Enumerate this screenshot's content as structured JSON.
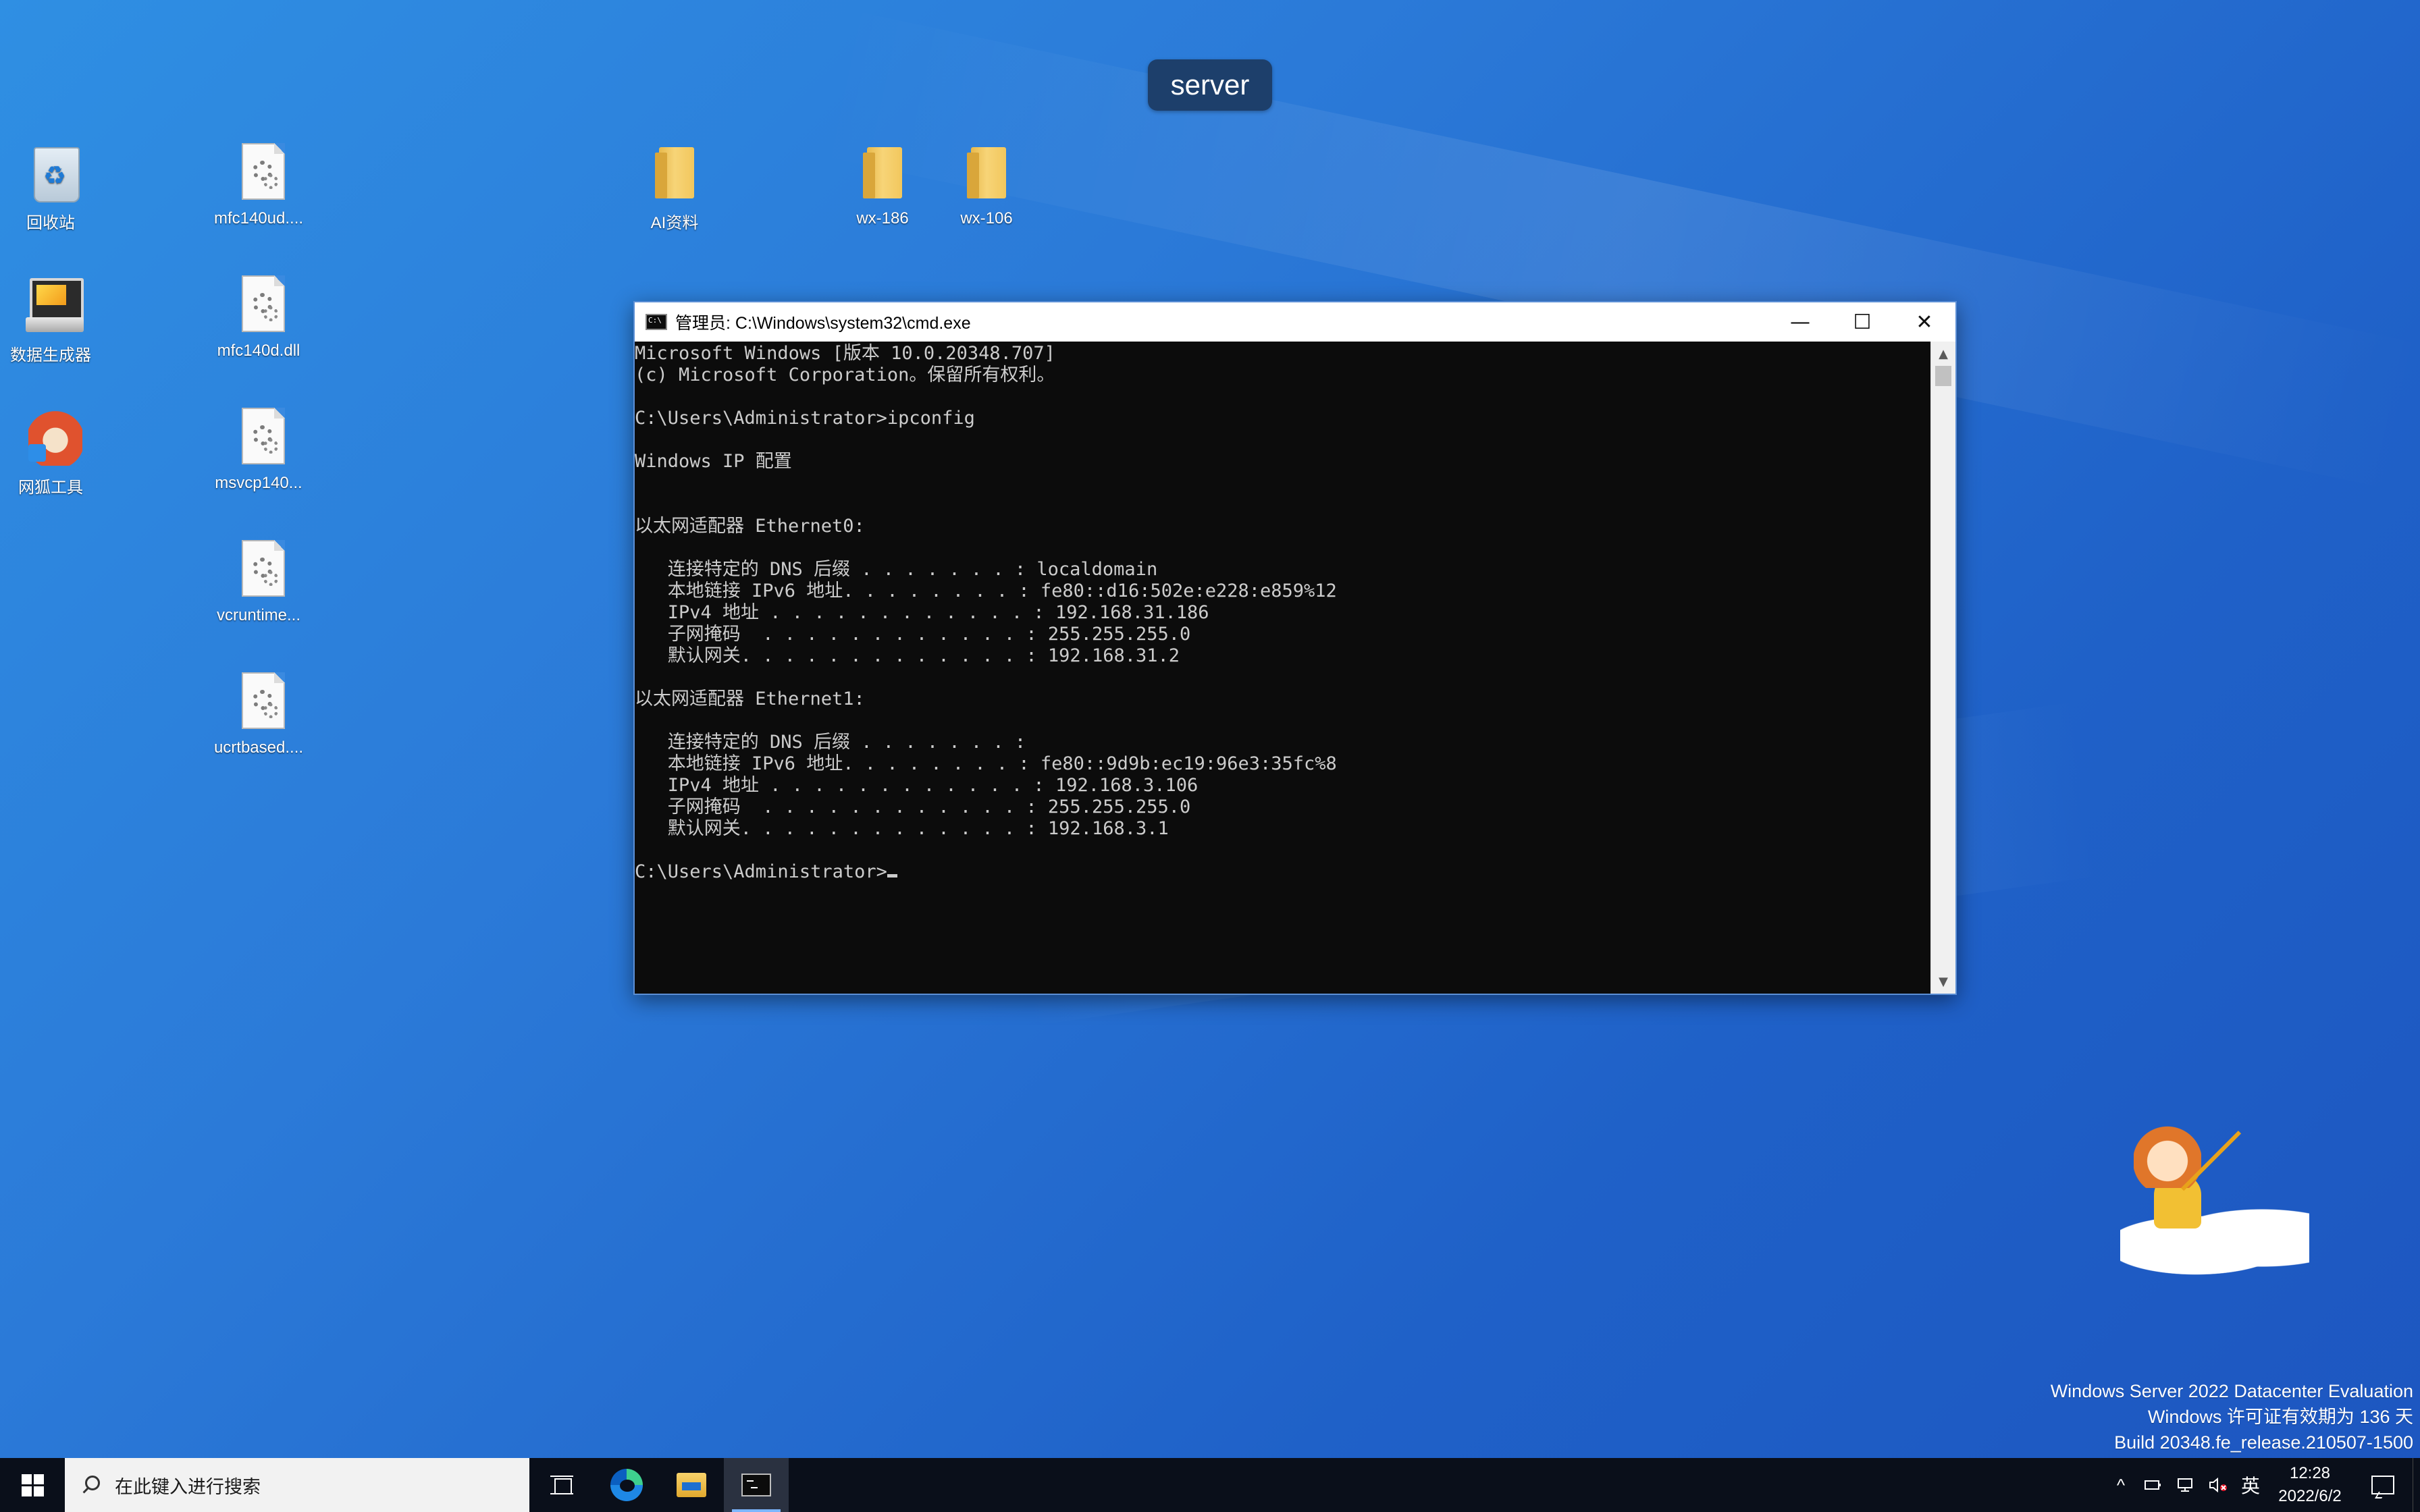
{
  "server_badge": "server",
  "desktop_icons": [
    {
      "label": "回收站",
      "icon": "recycle-bin-icon"
    },
    {
      "label": "mfc140ud....",
      "icon": "dll-file-icon"
    },
    {
      "label": "AI资料",
      "icon": "folder-icon"
    },
    {
      "label": "wx-186",
      "icon": "folder-icon"
    },
    {
      "label": "wx-106",
      "icon": "folder-icon"
    },
    {
      "label": "数据生成器",
      "icon": "computer-shortcut-icon"
    },
    {
      "label": "mfc140d.dll",
      "icon": "dll-file-icon"
    },
    {
      "label": "网狐工具",
      "icon": "fox-tool-icon"
    },
    {
      "label": "msvcp140...",
      "icon": "dll-file-icon"
    },
    {
      "label": "vcruntime...",
      "icon": "dll-file-icon"
    },
    {
      "label": "ucrtbased....",
      "icon": "dll-file-icon"
    }
  ],
  "cmd": {
    "title": "管理员: C:\\Windows\\system32\\cmd.exe",
    "minimize": "—",
    "maximize": "☐",
    "close": "✕",
    "lines": [
      "Microsoft Windows [版本 10.0.20348.707]",
      "(c) Microsoft Corporation。保留所有权利。",
      "",
      "C:\\Users\\Administrator>ipconfig",
      "",
      "Windows IP 配置",
      "",
      "",
      "以太网适配器 Ethernet0:",
      "",
      "   连接特定的 DNS 后缀 . . . . . . . : localdomain",
      "   本地链接 IPv6 地址. . . . . . . . : fe80::d16:502e:e228:e859%12",
      "   IPv4 地址 . . . . . . . . . . . . : 192.168.31.186",
      "   子网掩码  . . . . . . . . . . . . : 255.255.255.0",
      "   默认网关. . . . . . . . . . . . . : 192.168.31.2",
      "",
      "以太网适配器 Ethernet1:",
      "",
      "   连接特定的 DNS 后缀 . . . . . . . :",
      "   本地链接 IPv6 地址. . . . . . . . : fe80::9d9b:ec19:96e3:35fc%8",
      "   IPv4 地址 . . . . . . . . . . . . : 192.168.3.106",
      "   子网掩码  . . . . . . . . . . . . : 255.255.255.0",
      "   默认网关. . . . . . . . . . . . . : 192.168.3.1",
      "",
      "C:\\Users\\Administrator>"
    ],
    "scroll_up": "▲",
    "scroll_down": "▼"
  },
  "watermark": {
    "line1": "Windows Server 2022 Datacenter Evaluation",
    "line2": "Windows 许可证有效期为 136 天",
    "line3": "Build 20348.fe_release.210507-1500"
  },
  "taskbar": {
    "search_placeholder": "在此键入进行搜索",
    "tray": {
      "chevron": "^",
      "ime": "英",
      "time": "12:28",
      "date": "2022/6/2"
    }
  }
}
